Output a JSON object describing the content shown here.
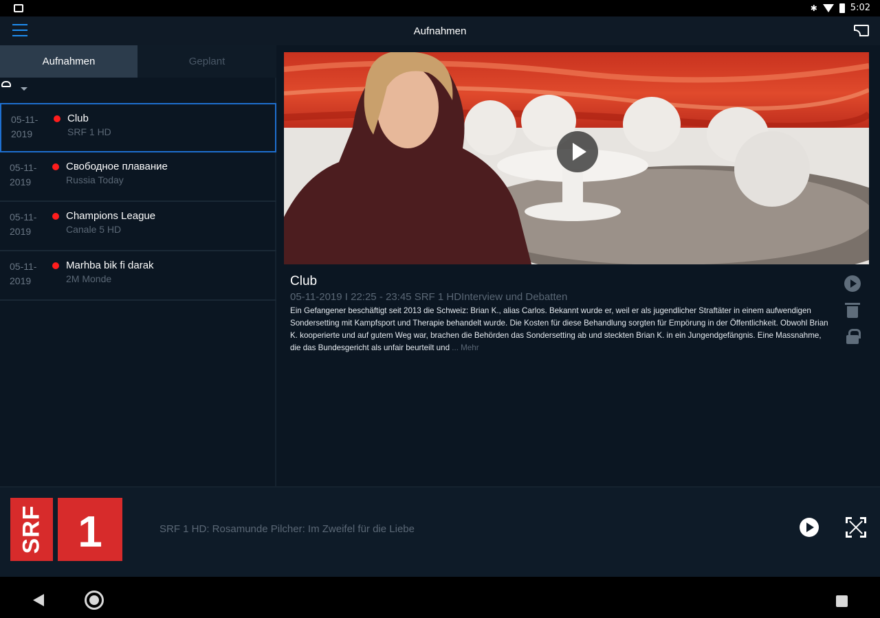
{
  "status_bar": {
    "time": "5:02"
  },
  "app_bar": {
    "title": "Aufnahmen"
  },
  "tabs": [
    {
      "label": "Aufnahmen"
    },
    {
      "label": "Geplant"
    }
  ],
  "recordings": [
    {
      "date_line1": "05-11-",
      "date_line2": "2019",
      "title": "Club",
      "channel": "SRF 1 HD"
    },
    {
      "date_line1": "05-11-",
      "date_line2": "2019",
      "title": "Свободное плавание",
      "channel": "Russia Today"
    },
    {
      "date_line1": "05-11-",
      "date_line2": "2019",
      "title": "Champions League",
      "channel": "Canale 5 HD"
    },
    {
      "date_line1": "05-11-",
      "date_line2": "2019",
      "title": "Marhba bik fi darak",
      "channel": "2M Monde"
    }
  ],
  "detail": {
    "title": "Club",
    "meta": "05-11-2019 I 22:25 - 23:45  SRF 1 HDInterview und Debatten",
    "description": "Ein Gefangener beschäftigt seit 2013 die Schweiz: Brian K., alias Carlos. Bekannt wurde er, weil er als jugendlicher Straftäter in einem aufwendigen Sondersetting mit Kampfsport und Therapie behandelt wurde. Die Kosten für diese Behandlung sorgten für Empörung in der Öffentlichkeit. Obwohl Brian K. kooperierte und auf gutem Weg war, brachen die Behörden das Sondersetting ab und steckten Brian K. in ein Jungendgefängnis. Eine Massnahme, die das Bundesgericht als unfair beurteilt und",
    "more": " ... Mehr"
  },
  "player": {
    "logo_text_srf": "SRF",
    "logo_text_one": "1",
    "now_playing": "SRF 1 HD: Rosamunde Pilcher: Im Zweifel für die Liebe"
  },
  "colors": {
    "accent": "#1e6fd0",
    "record_dot": "#ff1d1d",
    "srf_red": "#d72b2b",
    "background": "#0b1622"
  }
}
